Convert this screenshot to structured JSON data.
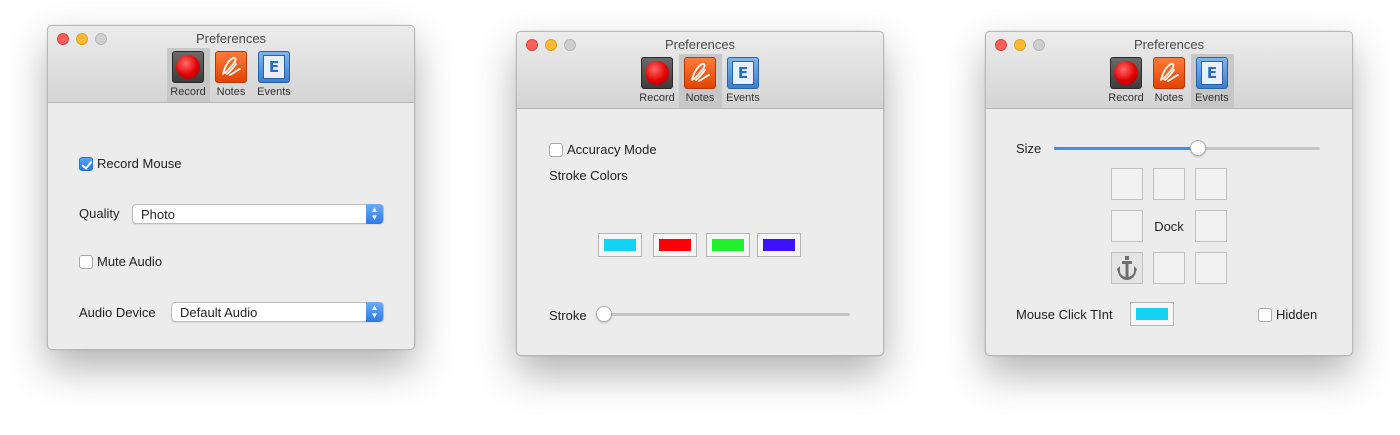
{
  "windows": [
    {
      "title": "Preferences",
      "toolbar": [
        {
          "label": "Record",
          "icon": "record-icon",
          "selected": true
        },
        {
          "label": "Notes",
          "icon": "notes-icon",
          "selected": false
        },
        {
          "label": "Events",
          "icon": "events-icon",
          "selected": false
        }
      ],
      "record": {
        "record_mouse_label": "Record Mouse",
        "record_mouse_checked": true,
        "quality_label": "Quality",
        "quality_value": "Photo",
        "mute_audio_label": "Mute Audio",
        "mute_audio_checked": false,
        "audio_device_label": "Audio Device",
        "audio_device_value": "Default Audio"
      }
    },
    {
      "title": "Preferences",
      "toolbar": [
        {
          "label": "Record",
          "icon": "record-icon",
          "selected": false
        },
        {
          "label": "Notes",
          "icon": "notes-icon",
          "selected": true
        },
        {
          "label": "Events",
          "icon": "events-icon",
          "selected": false
        }
      ],
      "notes": {
        "accuracy_mode_label": "Accuracy Mode",
        "accuracy_mode_checked": false,
        "stroke_colors_label": "Stroke Colors",
        "stroke_colors": [
          "#13d3f5",
          "#fb0007",
          "#21f02d",
          "#3e10f9"
        ],
        "stroke_label": "Stroke",
        "stroke_value": 0
      }
    },
    {
      "title": "Preferences",
      "toolbar": [
        {
          "label": "Record",
          "icon": "record-icon",
          "selected": false
        },
        {
          "label": "Notes",
          "icon": "notes-icon",
          "selected": false
        },
        {
          "label": "Events",
          "icon": "events-icon",
          "selected": true
        }
      ],
      "events": {
        "size_label": "Size",
        "size_value": 0.55,
        "dock_label": "Dock",
        "mouse_click_tint_label": "Mouse Click TInt",
        "mouse_click_tint_color": "#13d3f5",
        "hidden_label": "Hidden",
        "hidden_checked": false
      }
    }
  ],
  "colors": {
    "accent": "#2f7ff0",
    "window_bg": "#ececec"
  }
}
